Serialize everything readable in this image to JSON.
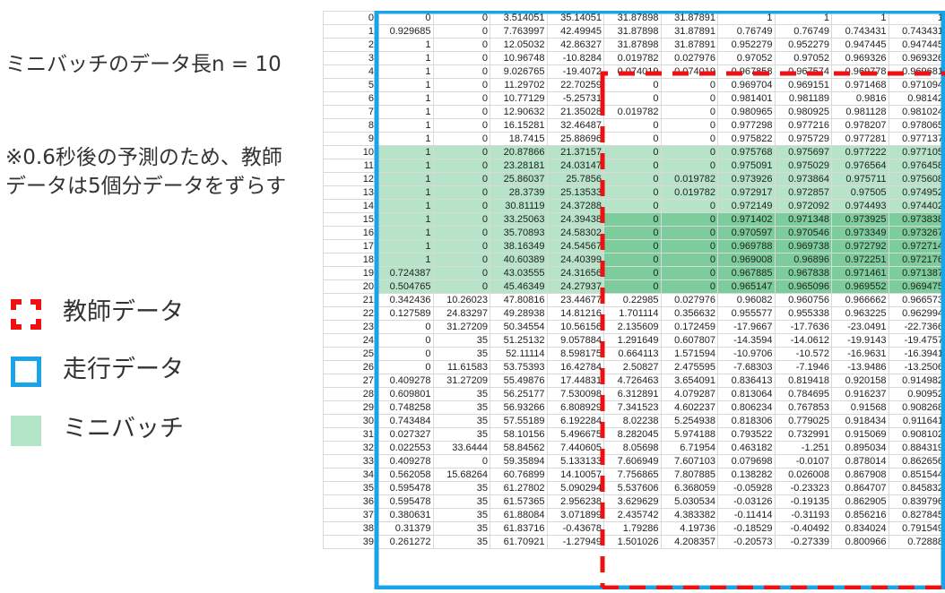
{
  "notes": {
    "minibatch_length": "ミニバッチのデータ長n = 10",
    "shift_note": "※0.6秒後の予測のため、教師データは5個分データをずらす"
  },
  "legend": [
    {
      "label": "教師データ",
      "color": "#ee1111",
      "icon": "red-dashed-square-icon"
    },
    {
      "label": "走行データ",
      "color": "#1aa3e6",
      "icon": "blue-square-icon"
    },
    {
      "label": "ミニバッチ",
      "color": "#b3e4c8",
      "icon": "green-fill-square-icon"
    }
  ],
  "colors": {
    "teacher": "#ee1111",
    "run": "#1aa3e6",
    "minibatch": "#b7e3c8",
    "minibatch_dark": "#7ccc9c"
  },
  "sheet": {
    "rows": [
      [
        "0",
        "0",
        "0",
        "3.514051",
        "35.14051",
        "31.87898",
        "31.87891",
        "1",
        "1",
        "1",
        "1"
      ],
      [
        "1",
        "0.929685",
        "0",
        "7.763997",
        "42.49945",
        "31.87898",
        "31.87891",
        "0.76749",
        "0.76749",
        "0.743431",
        "0.743431"
      ],
      [
        "2",
        "1",
        "0",
        "12.05032",
        "42.86327",
        "31.87898",
        "31.87891",
        "0.952279",
        "0.952279",
        "0.947445",
        "0.947445"
      ],
      [
        "3",
        "1",
        "0",
        "10.96748",
        "-10.8284",
        "0.019782",
        "0.027976",
        "0.97052",
        "0.97052",
        "0.969326",
        "0.969326"
      ],
      [
        "4",
        "1",
        "0",
        "9.026765",
        "-19.4072",
        "0.074019",
        "0.074019",
        "0.967858",
        "0.967574",
        "0.969778",
        "0.969681"
      ],
      [
        "5",
        "1",
        "0",
        "11.29702",
        "22.70259",
        "0",
        "0",
        "0.969704",
        "0.969151",
        "0.971468",
        "0.971094"
      ],
      [
        "6",
        "1",
        "0",
        "10.77129",
        "-5.25731",
        "0",
        "0",
        "0.981401",
        "0.981189",
        "0.9816",
        "0.98142"
      ],
      [
        "7",
        "1",
        "0",
        "12.90632",
        "21.35028",
        "0.019782",
        "0",
        "0.980965",
        "0.980925",
        "0.981128",
        "0.981024"
      ],
      [
        "8",
        "1",
        "0",
        "16.15281",
        "32.46487",
        "0",
        "0",
        "0.977298",
        "0.977216",
        "0.978207",
        "0.978065"
      ],
      [
        "9",
        "1",
        "0",
        "18.7415",
        "25.88696",
        "0",
        "0",
        "0.975822",
        "0.975729",
        "0.977281",
        "0.977137"
      ],
      [
        "10",
        "1",
        "0",
        "20.87866",
        "21.37157",
        "0",
        "0",
        "0.975768",
        "0.975697",
        "0.977222",
        "0.977105"
      ],
      [
        "11",
        "1",
        "0",
        "23.28181",
        "24.03147",
        "0",
        "0",
        "0.975091",
        "0.975029",
        "0.976564",
        "0.976458"
      ],
      [
        "12",
        "1",
        "0",
        "25.86037",
        "25.7856",
        "0",
        "0.019782",
        "0.973926",
        "0.973864",
        "0.975711",
        "0.975608"
      ],
      [
        "13",
        "1",
        "0",
        "28.3739",
        "25.13533",
        "0",
        "0.019782",
        "0.972917",
        "0.972857",
        "0.97505",
        "0.974952"
      ],
      [
        "14",
        "1",
        "0",
        "30.81119",
        "24.37288",
        "0",
        "0",
        "0.972149",
        "0.972092",
        "0.974493",
        "0.974402"
      ],
      [
        "15",
        "1",
        "0",
        "33.25063",
        "24.39438",
        "0",
        "0",
        "0.971402",
        "0.971348",
        "0.973925",
        "0.973838"
      ],
      [
        "16",
        "1",
        "0",
        "35.70893",
        "24.58302",
        "0",
        "0",
        "0.970597",
        "0.970546",
        "0.973349",
        "0.973267"
      ],
      [
        "17",
        "1",
        "0",
        "38.16349",
        "24.54567",
        "0",
        "0",
        "0.969788",
        "0.969738",
        "0.972792",
        "0.972714"
      ],
      [
        "18",
        "1",
        "0",
        "40.60389",
        "24.40399",
        "0",
        "0",
        "0.969008",
        "0.96896",
        "0.972251",
        "0.972176"
      ],
      [
        "19",
        "0.724387",
        "0",
        "43.03555",
        "24.31656",
        "0",
        "0",
        "0.967885",
        "0.967838",
        "0.971461",
        "0.971387"
      ],
      [
        "20",
        "0.504765",
        "0",
        "45.46349",
        "24.27937",
        "0",
        "0",
        "0.965147",
        "0.965096",
        "0.969552",
        "0.969475"
      ],
      [
        "21",
        "0.342436",
        "10.26023",
        "47.80816",
        "23.44677",
        "0.22985",
        "0.027976",
        "0.96082",
        "0.960756",
        "0.966662",
        "0.966573"
      ],
      [
        "22",
        "0.127589",
        "24.83297",
        "49.28938",
        "14.81216",
        "1.701114",
        "0.356632",
        "0.955577",
        "0.955338",
        "0.963225",
        "0.962994"
      ],
      [
        "23",
        "0",
        "31.27209",
        "50.34554",
        "10.56156",
        "2.135609",
        "0.172459",
        "-17.9667",
        "-17.7636",
        "-23.0491",
        "-22.7366"
      ],
      [
        "24",
        "0",
        "35",
        "51.25132",
        "9.057884",
        "1.291649",
        "0.607807",
        "-14.3594",
        "-14.0612",
        "-19.9143",
        "-19.4757"
      ],
      [
        "25",
        "0",
        "35",
        "52.11114",
        "8.598175",
        "0.664113",
        "1.571594",
        "-10.9706",
        "-10.572",
        "-16.9631",
        "-16.3941"
      ],
      [
        "26",
        "0",
        "11.61583",
        "53.75393",
        "16.42784",
        "2.50827",
        "2.475595",
        "-7.68303",
        "-7.1946",
        "-13.9486",
        "-13.2506"
      ],
      [
        "27",
        "0.409278",
        "31.27209",
        "55.49876",
        "17.44831",
        "4.726463",
        "3.654091",
        "0.836413",
        "0.819418",
        "0.920158",
        "0.914982"
      ],
      [
        "28",
        "0.609801",
        "35",
        "56.25177",
        "7.530098",
        "6.312891",
        "4.079287",
        "0.813064",
        "0.784695",
        "0.916237",
        "0.90952"
      ],
      [
        "29",
        "0.748258",
        "35",
        "56.93266",
        "6.808929",
        "7.341523",
        "4.602237",
        "0.806234",
        "0.767853",
        "0.91568",
        "0.908268"
      ],
      [
        "30",
        "0.743484",
        "35",
        "57.55189",
        "6.192284",
        "8.02238",
        "5.254938",
        "0.818306",
        "0.779025",
        "0.918434",
        "0.911641"
      ],
      [
        "31",
        "0.027327",
        "35",
        "58.10156",
        "5.496675",
        "8.282045",
        "5.974188",
        "0.793522",
        "0.732991",
        "0.915069",
        "0.908102"
      ],
      [
        "32",
        "0.022553",
        "33.6444",
        "58.84562",
        "7.440605",
        "8.05698",
        "6.71954",
        "0.463182",
        "-1.251",
        "0.895034",
        "0.884319"
      ],
      [
        "33",
        "0.409278",
        "0",
        "59.35894",
        "5.133133",
        "7.606949",
        "7.607103",
        "0.079698",
        "-0.0107",
        "0.878014",
        "0.862656"
      ],
      [
        "34",
        "0.562058",
        "15.68264",
        "60.76899",
        "14.10057",
        "7.756865",
        "7.807885",
        "0.138282",
        "0.026008",
        "0.867908",
        "0.851544"
      ],
      [
        "35",
        "0.595478",
        "35",
        "61.27802",
        "5.090294",
        "5.537606",
        "6.368059",
        "-0.05928",
        "-0.23323",
        "0.864707",
        "0.845832"
      ],
      [
        "36",
        "0.595478",
        "35",
        "61.57365",
        "2.956238",
        "3.629629",
        "5.030534",
        "-0.03126",
        "-0.19135",
        "0.862905",
        "0.839796"
      ],
      [
        "37",
        "0.380631",
        "35",
        "61.88084",
        "3.071899",
        "2.435742",
        "4.383382",
        "-0.11414",
        "-0.31193",
        "0.856216",
        "0.827845"
      ],
      [
        "38",
        "0.31379",
        "35",
        "61.83716",
        "-0.43678",
        "1.79286",
        "4.19736",
        "-0.18529",
        "-0.40492",
        "0.834024",
        "0.791549"
      ],
      [
        "39",
        "0.261272",
        "35",
        "61.70921",
        "-1.27949",
        "1.501026",
        "4.208357",
        "-0.20573",
        "-0.27339",
        "0.800966",
        "0.72888"
      ]
    ]
  }
}
